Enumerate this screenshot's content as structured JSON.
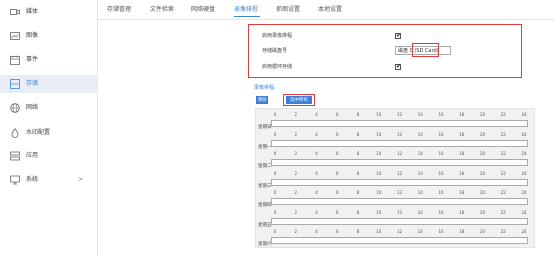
{
  "sidebar": {
    "items": [
      {
        "label": "媒体",
        "icon": "video-camera-icon",
        "active": false
      },
      {
        "label": "图像",
        "icon": "image-icon",
        "active": false
      },
      {
        "label": "事件",
        "icon": "calendar-icon",
        "active": false
      },
      {
        "label": "存储",
        "icon": "storage-icon",
        "active": true
      },
      {
        "label": "网络",
        "icon": "network-icon",
        "active": false
      },
      {
        "label": "水印配置",
        "icon": "watermark-icon",
        "active": false
      },
      {
        "label": "应用",
        "icon": "apps-icon",
        "active": false
      },
      {
        "label": "系统",
        "icon": "monitor-icon",
        "active": false,
        "arrow": ">"
      }
    ]
  },
  "tabs": [
    {
      "label": "存储管理",
      "active": false
    },
    {
      "label": "文件检索",
      "active": false
    },
    {
      "label": "网络硬盘",
      "active": false
    },
    {
      "label": "录像排程",
      "active": true
    },
    {
      "label": "抓图设置",
      "active": false
    },
    {
      "label": "本地设置",
      "active": false
    }
  ],
  "settings": {
    "enable_schedule_label": "启用录像排程",
    "enable_schedule_checked": true,
    "storage_disk_label": "存储磁盘号",
    "storage_disk_value": "磁盘 0 (SD Card)",
    "cyclic_storage_label": "启用循环存储",
    "cyclic_storage_checked": true,
    "checkmark": "✔"
  },
  "schedule": {
    "title": "录像排程:",
    "clear_button": "清除",
    "select_all_button": "选中所有",
    "hour_ticks": [
      "0",
      "2",
      "4",
      "6",
      "8",
      "10",
      "12",
      "14",
      "16",
      "18",
      "20",
      "22",
      "24"
    ],
    "days": [
      "星期日",
      "星期一",
      "星期二",
      "星期三",
      "星期四",
      "星期五",
      "星期六"
    ]
  },
  "colors": {
    "accent": "#3a87d8",
    "highlight_box": "#e23b3b",
    "button": "#3d7fd8"
  }
}
